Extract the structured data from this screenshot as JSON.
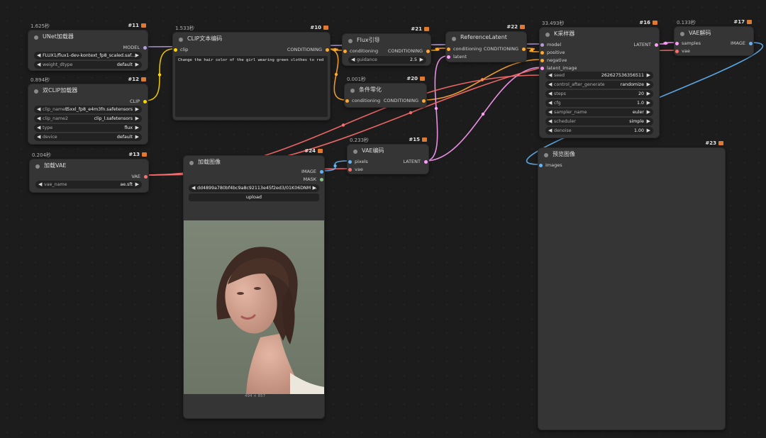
{
  "colors": {
    "model": "#b39ddb",
    "clip": "#ffd500",
    "conditioning": "#ffa931",
    "latent": "#ff9cf9",
    "vae": "#ff6e6e",
    "image": "#64b5f6",
    "mask": "#81c784"
  },
  "n11": {
    "timing": "1.625秒",
    "id": "#11",
    "title": "UNet加载器",
    "out": "MODEL",
    "w1_value": "FLUX1/flux1-dev-kontext_fp8_scaled.saf...",
    "w2_label": "weight_dtype",
    "w2_value": "default"
  },
  "n12": {
    "timing": "0.894秒",
    "id": "#12",
    "title": "双CLIP加载器",
    "out": "CLIP",
    "w1_label": "clip_name1",
    "w1_value": "t5xxl_fp8_e4m3fn.safetensors",
    "w2_label": "clip_name2",
    "w2_value": "clip_l.safetensors",
    "w3_label": "type",
    "w3_value": "flux",
    "w4_label": "device",
    "w4_value": "default"
  },
  "n13": {
    "timing": "0.204秒",
    "id": "#13",
    "title": "加载VAE",
    "out": "VAE",
    "w1_label": "vae_name",
    "w1_value": "ae.sft"
  },
  "n10": {
    "timing": "1.533秒",
    "id": "#10",
    "title": "CLIP文本编码",
    "in": "clip",
    "out": "CONDITIONING",
    "text": "Change the hair color of the girl wearing green clothes to red"
  },
  "n21": {
    "id": "#21",
    "title": "Flux引导",
    "in": "conditioning",
    "out": "CONDITIONING",
    "w1_label": "guidance",
    "w1_value": "2.5"
  },
  "n20": {
    "timing": "0.001秒",
    "id": "#20",
    "title": "条件零化",
    "in": "conditioning",
    "out": "CONDITIONING"
  },
  "n22": {
    "id": "#22",
    "title": "ReferenceLatent",
    "in1": "conditioning",
    "in2": "latent",
    "out": "CONDITIONING"
  },
  "n16": {
    "timing": "33.493秒",
    "id": "#16",
    "title": "K采样器",
    "in1": "model",
    "in2": "positive",
    "in3": "negative",
    "in4": "latent_image",
    "out": "LATENT",
    "w1_label": "seed",
    "w1_value": "262627536356511",
    "w2_label": "control_after_generate",
    "w2_value": "randomize",
    "w3_label": "steps",
    "w3_value": "20",
    "w4_label": "cfg",
    "w4_value": "1.0",
    "w5_label": "sampler_name",
    "w5_value": "euler",
    "w6_label": "scheduler",
    "w6_value": "simple",
    "w7_label": "denoise",
    "w7_value": "1.00"
  },
  "n17": {
    "timing": "0.133秒",
    "id": "#17",
    "title": "VAE解码",
    "in1": "samples",
    "in2": "vae",
    "out": "IMAGE"
  },
  "n15": {
    "timing": "0.233秒",
    "id": "#15",
    "title": "VAE编码",
    "in1": "pixels",
    "in2": "vae",
    "out": "LATENT"
  },
  "n24": {
    "id": "#24",
    "title": "加载图像",
    "out1": "IMAGE",
    "out2": "MASK",
    "file": "dd4899a780bf4bc9a8c92113e45f2ed3/01K06DNM ...",
    "upload": "upload",
    "dims": "494 × 857"
  },
  "n23": {
    "id": "#23",
    "title": "预览图像",
    "in": "images"
  }
}
